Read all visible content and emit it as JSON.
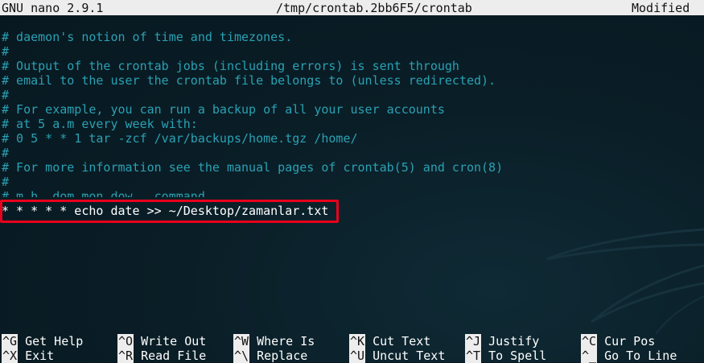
{
  "title_bar": {
    "app": "GNU nano 2.9.1",
    "file": "/tmp/crontab.2bb6F5/crontab",
    "status": "Modified"
  },
  "editor": {
    "lines": [
      "# daemon's notion of time and timezones.",
      "#",
      "# Output of the crontab jobs (including errors) is sent through",
      "# email to the user the crontab file belongs to (unless redirected).",
      "#",
      "# For example, you can run a backup of all your user accounts",
      "# at 5 a.m every week with:",
      "# 0 5 * * 1 tar -zcf /var/backups/home.tgz /home/",
      "#",
      "# For more information see the manual pages of crontab(5) and cron(8)",
      "#",
      "# m h  dom mon dow   command"
    ],
    "active_line": "* * * * * echo date >> ~/Desktop/zamanlar.txt"
  },
  "shortcuts": {
    "row1": [
      {
        "key": "^G",
        "label": "Get Help"
      },
      {
        "key": "^O",
        "label": "Write Out"
      },
      {
        "key": "^W",
        "label": "Where Is"
      },
      {
        "key": "^K",
        "label": "Cut Text"
      },
      {
        "key": "^J",
        "label": "Justify"
      },
      {
        "key": "^C",
        "label": "Cur Pos"
      }
    ],
    "row2": [
      {
        "key": "^X",
        "label": "Exit"
      },
      {
        "key": "^R",
        "label": "Read File"
      },
      {
        "key": "^\\",
        "label": "Replace"
      },
      {
        "key": "^U",
        "label": "Uncut Text"
      },
      {
        "key": "^T",
        "label": "To Spell"
      },
      {
        "key": "^_",
        "label": "Go To Line"
      }
    ]
  },
  "colors": {
    "comment": "#2aa1b3",
    "text": "#ffffff",
    "title_bar_bg": "#ededed",
    "highlight_border": "#e8001c",
    "background": "#0a1e27"
  }
}
